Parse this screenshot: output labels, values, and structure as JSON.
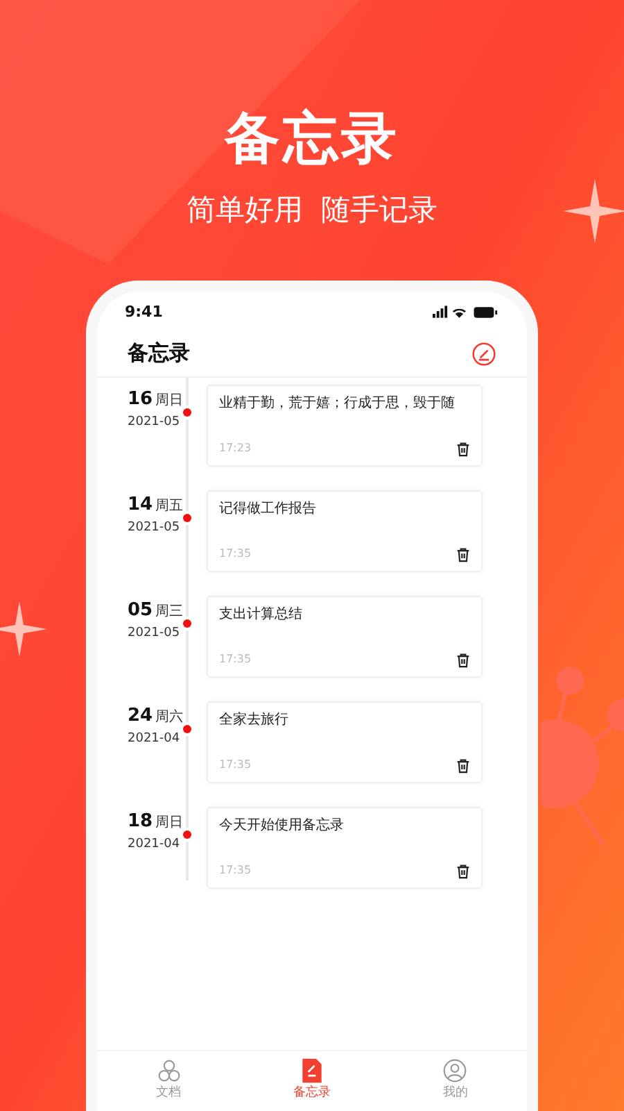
{
  "headline": "备忘录",
  "subtitle": "简单好用  随手记录",
  "phone": {
    "time": "9:41"
  },
  "header": {
    "title": "备忘录"
  },
  "entries": [
    {
      "day": "16",
      "weekday": "周日",
      "month": "2021-05",
      "text": "业精于勤，荒于嬉；行成于思，毁于随",
      "time": "17:23"
    },
    {
      "day": "14",
      "weekday": "周五",
      "month": "2021-05",
      "text": "记得做工作报告",
      "time": "17:35"
    },
    {
      "day": "05",
      "weekday": "周三",
      "month": "2021-05",
      "text": "支出计算总结",
      "time": "17:35"
    },
    {
      "day": "24",
      "weekday": "周六",
      "month": "2021-04",
      "text": "全家去旅行",
      "time": "17:35"
    },
    {
      "day": "18",
      "weekday": "周日",
      "month": "2021-04",
      "text": "今天开始使用备忘录",
      "time": "17:35"
    }
  ],
  "tabs": [
    {
      "kind": "docs",
      "label": "文档",
      "selected": false
    },
    {
      "kind": "memo",
      "label": "备忘录",
      "selected": true
    },
    {
      "kind": "me",
      "label": "我的",
      "selected": false
    }
  ]
}
